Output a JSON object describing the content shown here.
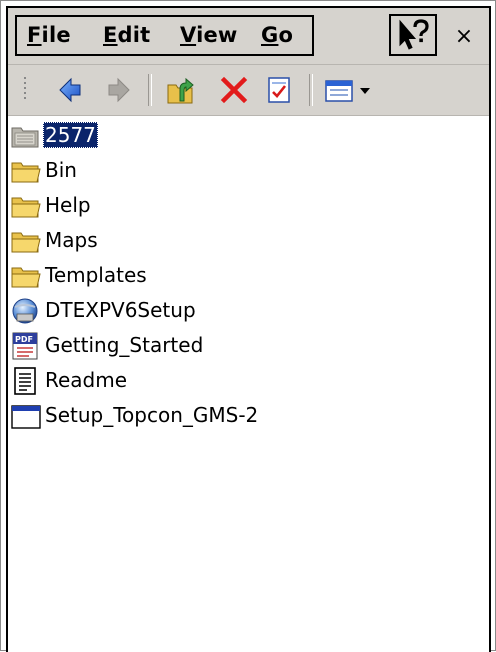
{
  "menubar": {
    "items": [
      {
        "label": "File",
        "mnemonic": "F",
        "rest": "ile"
      },
      {
        "label": "Edit",
        "mnemonic": "E",
        "rest": "dit"
      },
      {
        "label": "View",
        "mnemonic": "V",
        "rest": "iew"
      },
      {
        "label": "Go",
        "mnemonic": "G",
        "rest": "o"
      }
    ],
    "help_icon": "whats-this-help-icon",
    "close_label": "×"
  },
  "toolbar": {
    "buttons": [
      "back-icon",
      "forward-icon",
      "up-folder-icon",
      "delete-icon",
      "properties-icon",
      "views-icon"
    ]
  },
  "files": {
    "items": [
      {
        "name": "2577",
        "icon": "network-folder-icon",
        "selected": true
      },
      {
        "name": "Bin",
        "icon": "folder-icon"
      },
      {
        "name": "Help",
        "icon": "folder-icon"
      },
      {
        "name": "Maps",
        "icon": "folder-icon"
      },
      {
        "name": "Templates",
        "icon": "folder-icon"
      },
      {
        "name": "DTEXPV6Setup",
        "icon": "installer-icon"
      },
      {
        "name": "Getting_Started",
        "icon": "pdf-icon"
      },
      {
        "name": "Readme",
        "icon": "text-document-icon"
      },
      {
        "name": "Setup_Topcon_GMS-2",
        "icon": "application-icon"
      }
    ]
  },
  "colors": {
    "chrome": "#d6d3ce",
    "selection": "#0a246a",
    "folder": "#f4d46a"
  }
}
